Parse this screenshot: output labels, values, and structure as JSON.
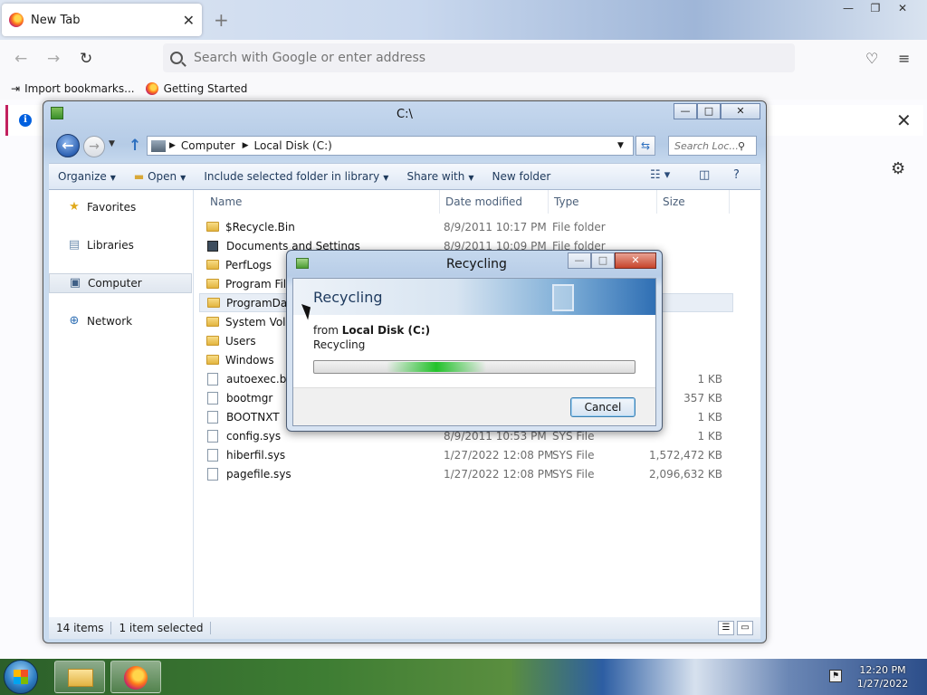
{
  "browser": {
    "tab_title": "New Tab",
    "tab_close": "✕",
    "new_tab": "+",
    "window_controls": [
      "—",
      "❐",
      "✕"
    ],
    "url_placeholder": "Search with Google or enter address",
    "bookmarks": [
      {
        "label": "Import bookmarks...",
        "icon": "import-icon"
      },
      {
        "label": "Getting Started",
        "icon": "firefox-icon"
      }
    ],
    "info_close": "✕"
  },
  "explorer": {
    "title": "C:\\",
    "breadcrumb": [
      "Computer",
      "Local Disk (C:)"
    ],
    "search_placeholder": "Search Loc...",
    "toolbar": {
      "organize": "Organize",
      "open": "Open",
      "include": "Include selected folder in library",
      "share": "Share with",
      "new_folder": "New folder"
    },
    "nav": [
      {
        "label": "Favorites",
        "icon": "star-icon"
      },
      {
        "label": "Libraries",
        "icon": "library-icon"
      },
      {
        "label": "Computer",
        "icon": "computer-icon"
      },
      {
        "label": "Network",
        "icon": "network-icon"
      }
    ],
    "columns": {
      "name": "Name",
      "date": "Date modified",
      "type": "Type",
      "size": "Size"
    },
    "files": [
      {
        "name": "$Recycle.Bin",
        "date": "8/9/2011 10:17 PM",
        "type": "File folder",
        "size": "",
        "kind": "folder"
      },
      {
        "name": "Documents and Settings",
        "date": "8/9/2011 10:09 PM",
        "type": "File folder",
        "size": "",
        "kind": "link"
      },
      {
        "name": "PerfLogs",
        "date": "",
        "type": "",
        "size": "",
        "kind": "folder"
      },
      {
        "name": "Program Files",
        "date": "",
        "type": "",
        "size": "",
        "kind": "folder"
      },
      {
        "name": "ProgramData",
        "date": "",
        "type": "",
        "size": "",
        "kind": "folder"
      },
      {
        "name": "System Volume Information",
        "date": "",
        "type": "",
        "size": "",
        "kind": "folder"
      },
      {
        "name": "Users",
        "date": "",
        "type": "",
        "size": "",
        "kind": "folder"
      },
      {
        "name": "Windows",
        "date": "",
        "type": "",
        "size": "",
        "kind": "folder"
      },
      {
        "name": "autoexec.bat",
        "date": "",
        "type": "",
        "size": "1 KB",
        "kind": "file"
      },
      {
        "name": "bootmgr",
        "date": "",
        "type": "",
        "size": "357 KB",
        "kind": "file"
      },
      {
        "name": "BOOTNXT",
        "date": "",
        "type": "",
        "size": "1 KB",
        "kind": "file"
      },
      {
        "name": "config.sys",
        "date": "8/9/2011 10:53 PM",
        "type": "SYS File",
        "size": "1 KB",
        "kind": "file"
      },
      {
        "name": "hiberfil.sys",
        "date": "1/27/2022 12:08 PM",
        "type": "SYS File",
        "size": "1,572,472 KB",
        "kind": "file"
      },
      {
        "name": "pagefile.sys",
        "date": "1/27/2022 12:08 PM",
        "type": "SYS File",
        "size": "2,096,632 KB",
        "kind": "file"
      }
    ],
    "selected_index": 4,
    "status": {
      "count": "14 items",
      "selected": "1 item selected"
    }
  },
  "dialog": {
    "title": "Recycling",
    "heading": "Recycling",
    "from_prefix": "from",
    "from_location": "Local Disk (C:)",
    "status": "Recycling",
    "cancel": "Cancel",
    "progress_indeterminate": true
  },
  "taskbar": {
    "time": "12:20 PM",
    "date": "1/27/2022"
  }
}
